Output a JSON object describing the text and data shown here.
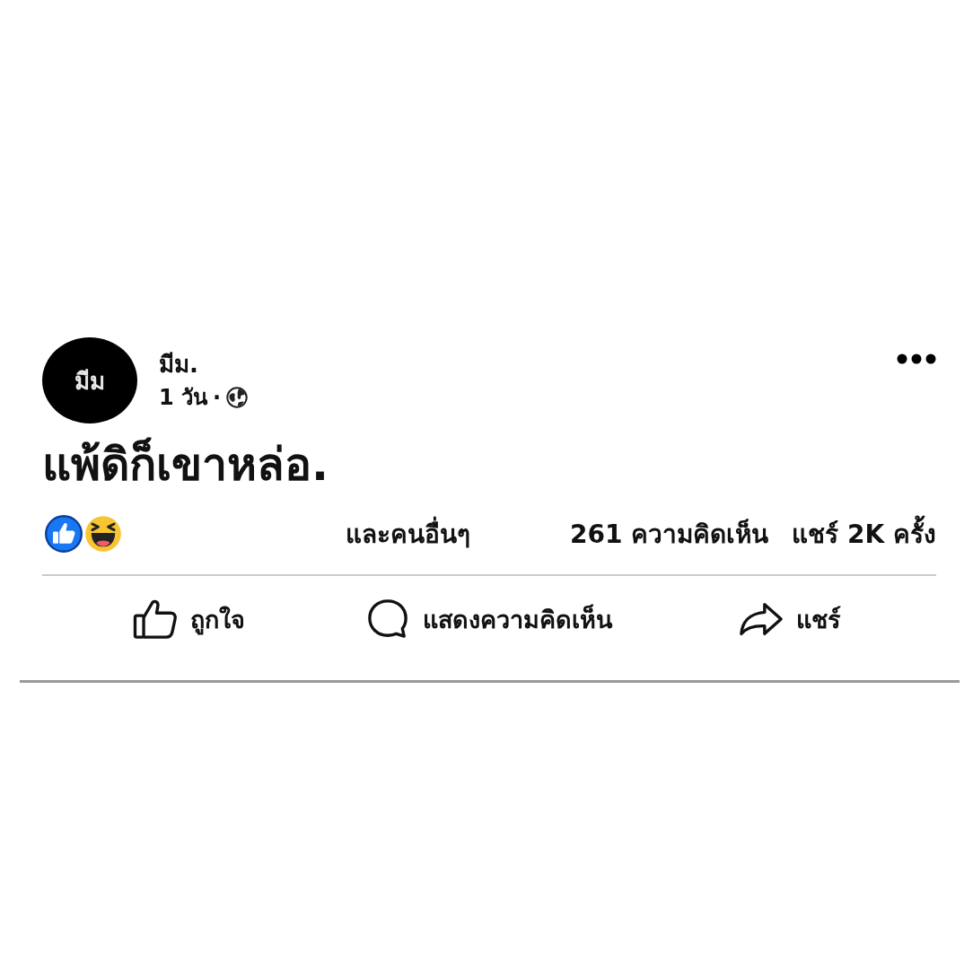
{
  "post": {
    "author": {
      "avatar_text": "มีม",
      "name": "มีม.",
      "time": "1 วัน",
      "separator": "·"
    },
    "text": "แพ้ดิก็เขาหล่อ.",
    "reactions": {
      "types": [
        {
          "kind": "like"
        },
        {
          "kind": "haha"
        }
      ],
      "others": "และคนอื่นๆ",
      "comments": "261 ความคิดเห็น",
      "shares": "แชร์ 2K ครั้ง"
    },
    "actions": [
      {
        "kind": "like",
        "label": "ถูกใจ"
      },
      {
        "kind": "comment",
        "label": "แสดงความคิดเห็น"
      },
      {
        "kind": "share",
        "label": "แชร์"
      }
    ]
  }
}
